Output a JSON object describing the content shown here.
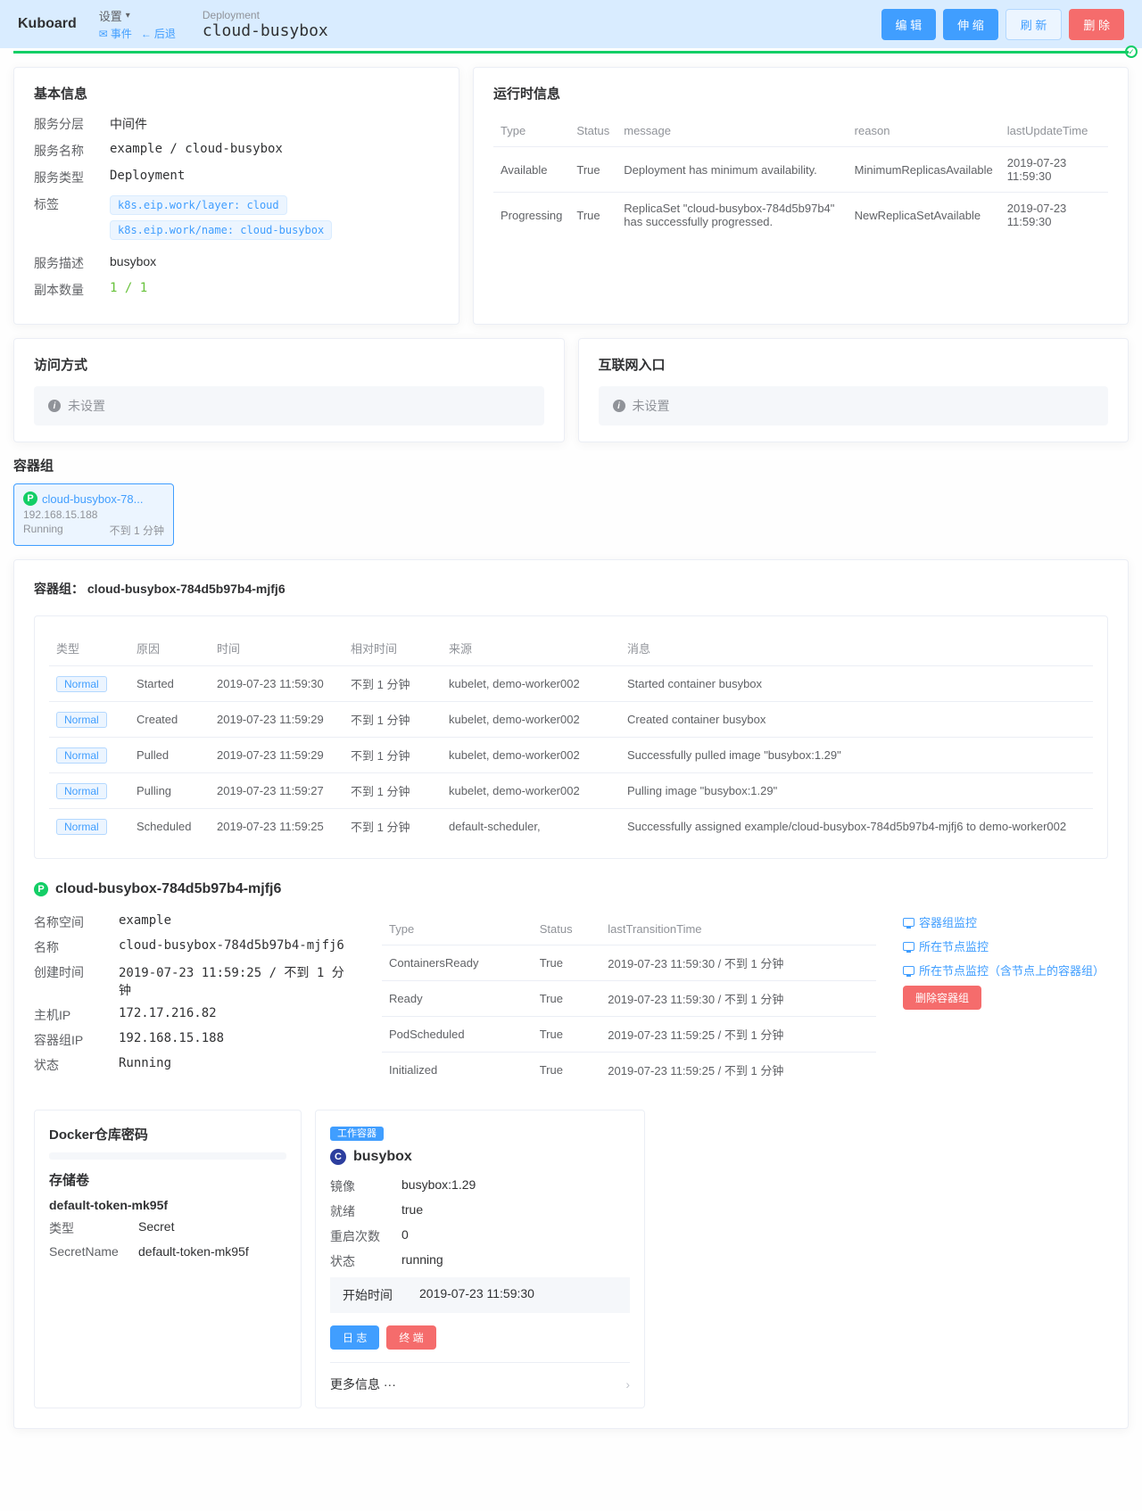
{
  "header": {
    "brand": "Kuboard",
    "settings": "设置",
    "events": "事件",
    "back": "后退",
    "resourceType": "Deployment",
    "resourceName": "cloud-busybox",
    "btnEdit": "编 辑",
    "btnScale": "伸 缩",
    "btnRefresh": "刷 新",
    "btnDelete": "删 除"
  },
  "basic": {
    "title": "基本信息",
    "layerLabel": "服务分层",
    "layerValue": "中间件",
    "nameLabel": "服务名称",
    "nameValue": "example / cloud-busybox",
    "typeLabel": "服务类型",
    "typeValue": "Deployment",
    "tagsLabel": "标签",
    "tag1": "k8s.eip.work/layer: cloud",
    "tag2": "k8s.eip.work/name: cloud-busybox",
    "descLabel": "服务描述",
    "descValue": "busybox",
    "replicaLabel": "副本数量",
    "replicaValue": "1 / 1"
  },
  "runtime": {
    "title": "运行时信息",
    "hType": "Type",
    "hStatus": "Status",
    "hMessage": "message",
    "hReason": "reason",
    "hTime": "lastUpdateTime",
    "rows": [
      {
        "type": "Available",
        "status": "True",
        "message": "Deployment has minimum availability.",
        "reason": "MinimumReplicasAvailable",
        "time": "2019-07-23 11:59:30"
      },
      {
        "type": "Progressing",
        "status": "True",
        "message": "ReplicaSet \"cloud-busybox-784d5b97b4\" has successfully progressed.",
        "reason": "NewReplicaSetAvailable",
        "time": "2019-07-23 11:59:30"
      }
    ]
  },
  "access": {
    "title": "访问方式",
    "unset": "未设置"
  },
  "ingress": {
    "title": "互联网入口",
    "unset": "未设置"
  },
  "pods": {
    "title": "容器组",
    "card": {
      "name": "cloud-busybox-78...",
      "ip": "192.168.15.188",
      "status": "Running",
      "age": "不到 1 分钟"
    }
  },
  "podGroup": {
    "titlePrefix": "容器组：",
    "name": "cloud-busybox-784d5b97b4-mjfj6",
    "hType": "类型",
    "hReason": "原因",
    "hTime": "时间",
    "hRel": "相对时间",
    "hSource": "来源",
    "hMsg": "消息",
    "events": [
      {
        "type": "Normal",
        "reason": "Started",
        "time": "2019-07-23 11:59:30",
        "rel": "不到 1 分钟",
        "source": "kubelet, demo-worker002",
        "msg": "Started container busybox"
      },
      {
        "type": "Normal",
        "reason": "Created",
        "time": "2019-07-23 11:59:29",
        "rel": "不到 1 分钟",
        "source": "kubelet, demo-worker002",
        "msg": "Created container busybox"
      },
      {
        "type": "Normal",
        "reason": "Pulled",
        "time": "2019-07-23 11:59:29",
        "rel": "不到 1 分钟",
        "source": "kubelet, demo-worker002",
        "msg": "Successfully pulled image \"busybox:1.29\""
      },
      {
        "type": "Normal",
        "reason": "Pulling",
        "time": "2019-07-23 11:59:27",
        "rel": "不到 1 分钟",
        "source": "kubelet, demo-worker002",
        "msg": "Pulling image \"busybox:1.29\""
      },
      {
        "type": "Normal",
        "reason": "Scheduled",
        "time": "2019-07-23 11:59:25",
        "rel": "不到 1 分钟",
        "source": "default-scheduler,",
        "msg": "Successfully assigned example/cloud-busybox-784d5b97b4-mjfj6 to demo-worker002"
      }
    ]
  },
  "podDetail": {
    "name": "cloud-busybox-784d5b97b4-mjfj6",
    "nsLabel": "名称空间",
    "nsValue": "example",
    "nameLabel": "名称",
    "nameValue": "cloud-busybox-784d5b97b4-mjfj6",
    "createdLabel": "创建时间",
    "createdValue": "2019-07-23 11:59:25 / 不到 1 分钟",
    "hostIpLabel": "主机IP",
    "hostIpValue": "172.17.216.82",
    "podIpLabel": "容器组IP",
    "podIpValue": "192.168.15.188",
    "statusLabel": "状态",
    "statusValue": "Running",
    "hType": "Type",
    "hStatus": "Status",
    "hTrans": "lastTransitionTime",
    "conditions": [
      {
        "type": "ContainersReady",
        "status": "True",
        "time": "2019-07-23 11:59:30 / 不到 1 分钟"
      },
      {
        "type": "Ready",
        "status": "True",
        "time": "2019-07-23 11:59:30 / 不到 1 分钟"
      },
      {
        "type": "PodScheduled",
        "status": "True",
        "time": "2019-07-23 11:59:25 / 不到 1 分钟"
      },
      {
        "type": "Initialized",
        "status": "True",
        "time": "2019-07-23 11:59:25 / 不到 1 分钟"
      }
    ],
    "linkPodMon": "容器组监控",
    "linkNodeMon": "所在节点监控",
    "linkNodePodsMon": "所在节点监控（含节点上的容器组）",
    "btnDeletePod": "删除容器组"
  },
  "docker": {
    "title": "Docker仓库密码",
    "volumeTitle": "存储卷",
    "volumeName": "default-token-mk95f",
    "typeLabel": "类型",
    "typeValue": "Secret",
    "secretLabel": "SecretName",
    "secretValue": "default-token-mk95f"
  },
  "container": {
    "badge": "工作容器",
    "name": "busybox",
    "imageLabel": "镜像",
    "imageValue": "busybox:1.29",
    "readyLabel": "就绪",
    "readyValue": "true",
    "restartLabel": "重启次数",
    "restartValue": "0",
    "stateLabel": "状态",
    "stateValue": "running",
    "startLabel": "开始时间",
    "startValue": "2019-07-23 11:59:30",
    "btnLog": "日 志",
    "btnTerm": "终 端",
    "more": "更多信息 ···"
  }
}
